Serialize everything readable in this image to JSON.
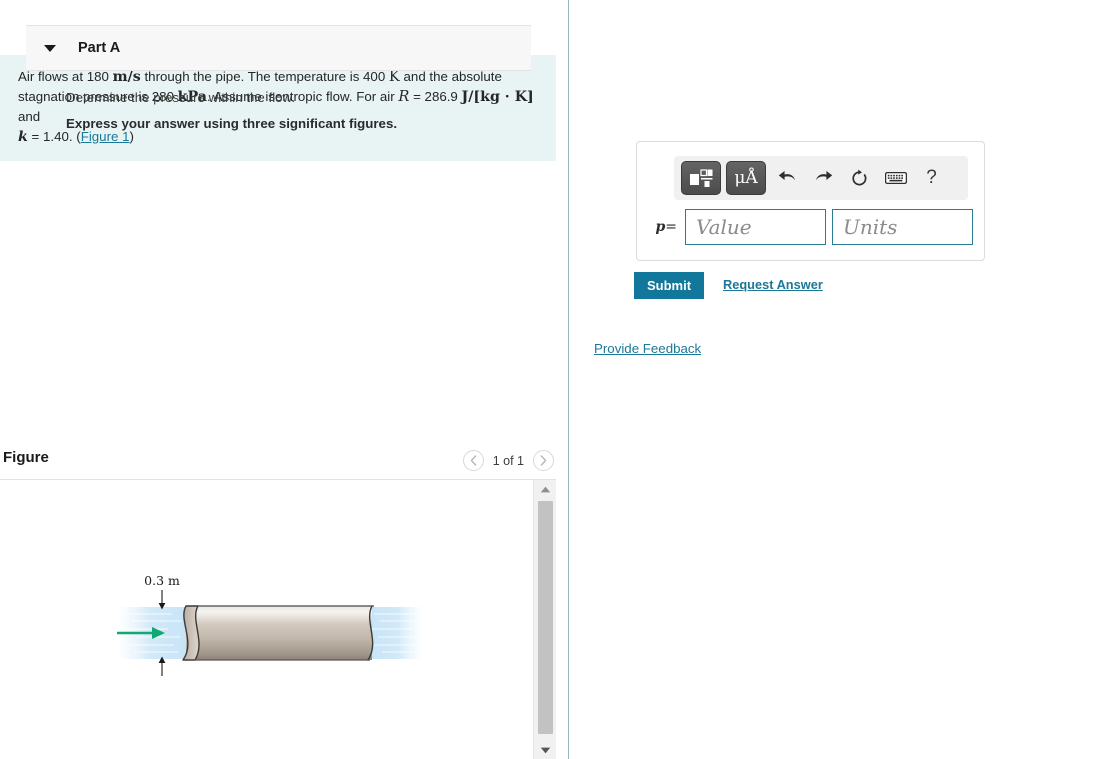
{
  "problem": {
    "line1_a": "Air flows at 180 ",
    "line1_ms": "m/s",
    "line1_b": " through the pipe. The temperature is 400 ",
    "line1_k": "K",
    "line1_c": " and the absolute",
    "line2_a": "stagnation pressure is 280 ",
    "line2_kpa": "kPa",
    "line2_b": ". Assume isentropic flow. For air ",
    "line2_r": "R",
    "line2_c": " = 286.9 ",
    "line2_units": "J/[kg · K]",
    "line2_d": " and",
    "line3_k": "k",
    "line3_a": " = 1.40. (",
    "figure_link": "Figure 1",
    "line3_b": ")"
  },
  "figure": {
    "title": "Figure",
    "pager_label": "1 of 1",
    "prev_icon": "chevron-left-icon",
    "next_icon": "chevron-right-icon",
    "dimension_label": "0.3 m",
    "pipe_color_top": "#f2efec",
    "pipe_color_mid": "#c9bfb4",
    "pipe_color_bottom": "#8e857c",
    "flow_color": "#cfe8f7",
    "arrow_color": "#13a871"
  },
  "scrollbar": {
    "up_icon": "triangle-up-icon",
    "down_icon": "triangle-down-icon"
  },
  "part": {
    "title": "Part A",
    "caret_icon": "caret-down-icon",
    "question": "Determine the pressure within the flow.",
    "instruction": "Express your answer using three significant figures."
  },
  "answer": {
    "toolbar": [
      {
        "name": "math-template-button",
        "label": "",
        "icon": "math-template-icon"
      },
      {
        "name": "units-button",
        "label": "μÅ",
        "icon": "units-icon"
      },
      {
        "name": "undo-button",
        "label": "↶",
        "icon": "undo-icon"
      },
      {
        "name": "redo-button",
        "label": "↷",
        "icon": "redo-icon"
      },
      {
        "name": "reset-button",
        "label": "↻",
        "icon": "reset-icon"
      },
      {
        "name": "keyboard-button",
        "label": "⌨",
        "icon": "keyboard-icon"
      },
      {
        "name": "help-button",
        "label": "?",
        "icon": "help-icon"
      }
    ],
    "variable_label": "p",
    "equals": "=",
    "value_placeholder": "Value",
    "value_text": "",
    "units_placeholder": "Units",
    "units_text": ""
  },
  "actions": {
    "submit_label": "Submit",
    "request_answer_label": "Request Answer",
    "provide_feedback_label": "Provide Feedback"
  },
  "colors": {
    "accent_teal": "#12789b",
    "link_blue": "#1b7898",
    "problem_bg": "#e7f4f3",
    "part_header_bg": "#f7f7f7"
  }
}
